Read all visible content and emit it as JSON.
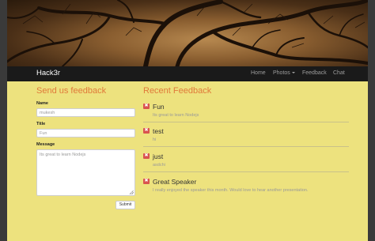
{
  "navbar": {
    "brand": "Hack3r",
    "items": [
      "Home",
      "Photos",
      "Feedback",
      "Chat"
    ]
  },
  "form": {
    "heading": "Send us feedback",
    "name_label": "Name",
    "name_value": "mukesh",
    "title_label": "Title",
    "title_value": "Fun",
    "message_label": "Message",
    "message_value": "Its great to learn Nodejs",
    "submit_label": "Submit"
  },
  "feedback": {
    "heading": "Recent Feedback",
    "delete_glyph": "✖",
    "items": [
      {
        "title": "Fun",
        "message": "Its great to learn Nodejs"
      },
      {
        "title": "test",
        "message": "hi"
      },
      {
        "title": "just",
        "message": "asdchi"
      },
      {
        "title": "Great Speaker",
        "message": "I really enjoyed the speaker this month. Would love to hear another presentation."
      }
    ]
  },
  "colors": {
    "page_bg": "#ede27e",
    "heading": "#e07a3a",
    "navbar": "#1a1a1a",
    "delete": "#d9534f"
  }
}
